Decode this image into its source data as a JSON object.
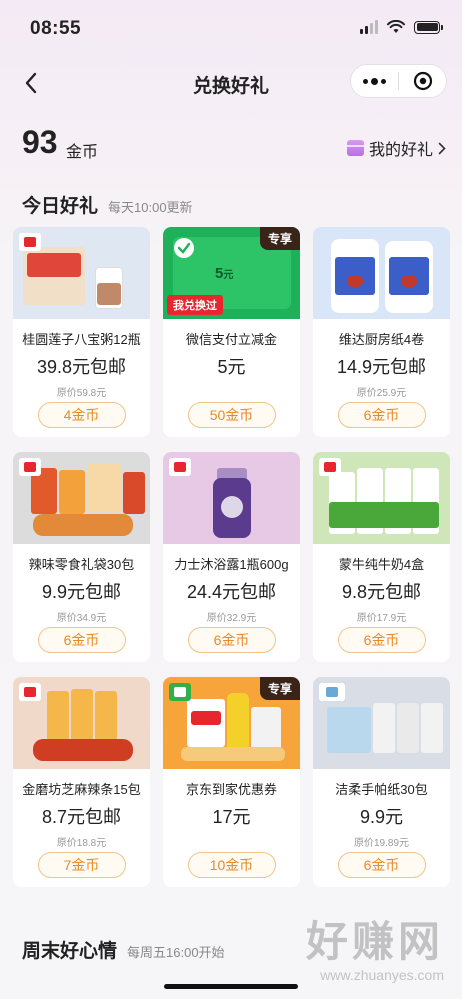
{
  "status": {
    "time": "08:55"
  },
  "nav": {
    "title": "兑换好礼"
  },
  "coins": {
    "count": "93",
    "unit": "金币",
    "my_gifts": "我的好礼"
  },
  "today": {
    "title": "今日好礼",
    "subtitle": "每天10:00更新"
  },
  "products": [
    {
      "name": "桂圆莲子八宝粥12瓶",
      "price": "39.8元包邮",
      "orig": "原价59.8元",
      "cost": "4金币"
    },
    {
      "name": "微信支付立减金",
      "price": "5元",
      "orig": "",
      "cost": "50金币",
      "tag": "专享",
      "badge": "我兑换过",
      "face_value": "5",
      "face_unit": "元"
    },
    {
      "name": "维达厨房纸4卷",
      "price": "14.9元包邮",
      "orig": "原价25.9元",
      "cost": "6金币"
    },
    {
      "name": "辣味零食礼袋30包",
      "price": "9.9元包邮",
      "orig": "原价34.9元",
      "cost": "6金币"
    },
    {
      "name": "力士沐浴露1瓶600g",
      "price": "24.4元包邮",
      "orig": "原价32.9元",
      "cost": "6金币"
    },
    {
      "name": "蒙牛纯牛奶4盒",
      "price": "9.8元包邮",
      "orig": "原价17.9元",
      "cost": "6金币"
    },
    {
      "name": "金磨坊芝麻辣条15包",
      "price": "8.7元包邮",
      "orig": "原价18.8元",
      "cost": "7金币"
    },
    {
      "name": "京东到家优惠券",
      "price": "17元",
      "orig": "",
      "cost": "10金币",
      "tag": "专享"
    },
    {
      "name": "洁柔手帕纸30包",
      "price": "9.9元",
      "orig": "原价19.89元",
      "cost": "6金币"
    }
  ],
  "weekend": {
    "title": "周末好心情",
    "subtitle": "每周五16:00开始"
  },
  "watermark": {
    "big": "好赚网",
    "small": "www.zhuanyes.com"
  },
  "colors": {
    "accent": "#e98a26",
    "special_tag_bg": "#3a2418",
    "redeemed_badge_bg": "#e8262d"
  }
}
